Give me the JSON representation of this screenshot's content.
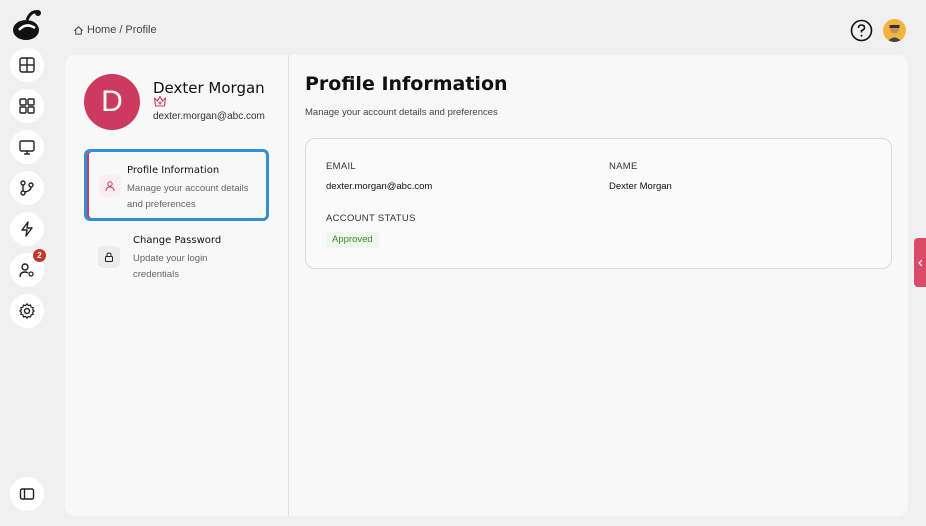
{
  "breadcrumb": {
    "home": "Home",
    "separator": "/",
    "current": "Profile"
  },
  "sidebar_badge": "2",
  "profile": {
    "initial": "D",
    "name": "Dexter Morgan",
    "email": "dexter.morgan@abc.com"
  },
  "menu": [
    {
      "title": "Profile Information",
      "description": "Manage your account details and preferences"
    },
    {
      "title": "Change Password",
      "description": "Update your login credentials"
    }
  ],
  "content": {
    "title": "Profile Information",
    "subtitle": "Manage your account details and preferences",
    "email_label": "EMAIL",
    "email_value": "dexter.morgan@abc.com",
    "name_label": "NAME",
    "name_value": "Dexter Morgan",
    "status_label": "ACCOUNT STATUS",
    "status_value": "Approved"
  },
  "colors": {
    "accent": "#cc3b5e",
    "focus": "#2f8fd8",
    "success": "#3d8b2f"
  }
}
